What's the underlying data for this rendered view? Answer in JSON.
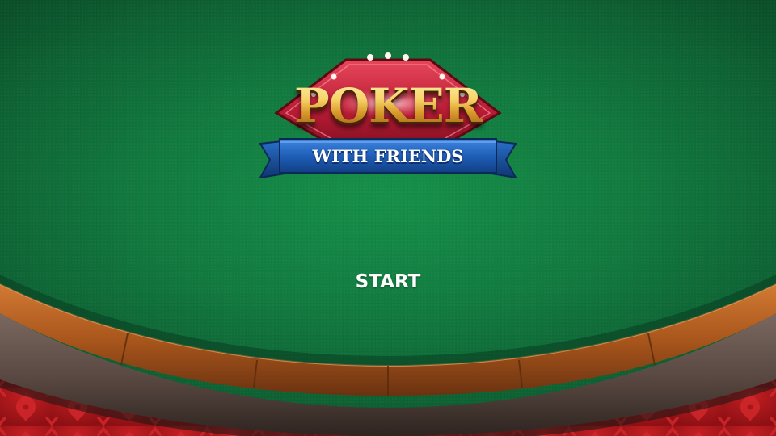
{
  "logo": {
    "title": "POKER",
    "subtitle": "WITH FRIENDS"
  },
  "menu": {
    "start_label": "START"
  },
  "colors": {
    "felt": "#127a3f",
    "rail_wood": "#a9561c",
    "rail_leather": "#5b4a43",
    "carpet": "#b3181c",
    "banner_blue": "#1f5fb8",
    "logo_red": "#b81c34",
    "logo_gold": "#f2c85a"
  },
  "icons": {
    "logo_bulbs": "light-bulb-icon",
    "carpet_pattern": "damask-ornament-icon"
  }
}
